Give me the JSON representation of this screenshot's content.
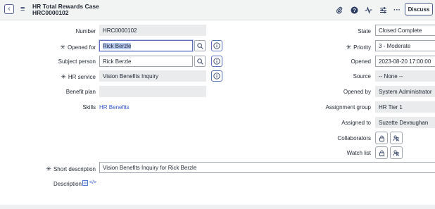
{
  "header": {
    "title": "HR Total Rewards Case",
    "number": "HRC0000102",
    "discuss_label": "Discuss"
  },
  "icons": {
    "back": "‹",
    "menu": "≡",
    "attach": "📎",
    "help": "?",
    "activity": "⚡",
    "settings": "☰",
    "more": "···",
    "search": "⌕",
    "info": "ⓘ",
    "lock": "🔒",
    "users": "👥",
    "required": "✳",
    "doc": "▤",
    "code": "</>"
  },
  "form": {
    "number": {
      "label": "Number",
      "value": "HRC0000102"
    },
    "opened_for": {
      "label": "Opened for",
      "value": "Rick Berzle"
    },
    "subject_person": {
      "label": "Subject person",
      "value": "Rick Berzle"
    },
    "hr_service": {
      "label": "HR service",
      "value": "Vision Benefits Inquiry"
    },
    "benefit_plan": {
      "label": "Benefit plan",
      "value": ""
    },
    "skills": {
      "label": "Skills",
      "value": "HR Benefits"
    },
    "state": {
      "label": "State",
      "value": "Closed Complete"
    },
    "priority": {
      "label": "Priority",
      "value": "3 - Moderate"
    },
    "opened": {
      "label": "Opened",
      "value": "2023-08-20 17:00:00"
    },
    "source": {
      "label": "Source",
      "value": "-- None --"
    },
    "opened_by": {
      "label": "Opened by",
      "value": "System Administrator"
    },
    "assignment_group": {
      "label": "Assignment group",
      "value": "HR Tier 1"
    },
    "assigned_to": {
      "label": "Assigned to",
      "value": "Suzette Devaughan"
    },
    "collaborators": {
      "label": "Collaborators"
    },
    "watch_list": {
      "label": "Watch list"
    },
    "short_description": {
      "label": "Short description",
      "value": "Vision Benefits Inquiry for Rick Berzle"
    },
    "description": {
      "label": "Description"
    }
  }
}
